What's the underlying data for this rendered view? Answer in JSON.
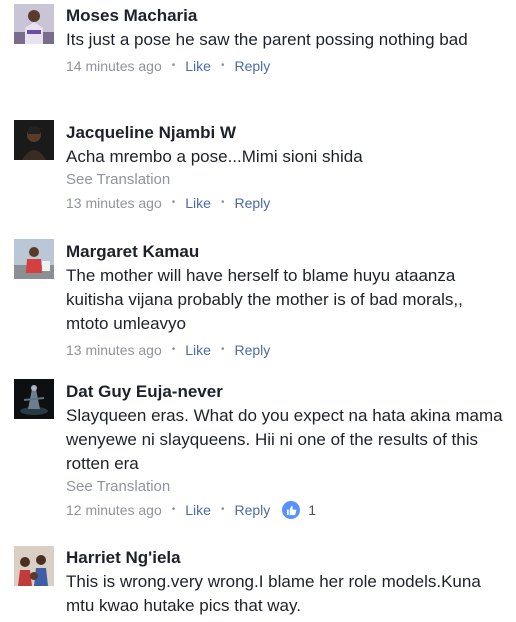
{
  "comments": [
    {
      "author": "Moses Macharia",
      "text": "Its just a pose he saw the parent possing nothing bad",
      "see_translation": "",
      "time": "14 minutes ago",
      "like_label": "Like",
      "reply_label": "Reply",
      "reactions": ""
    },
    {
      "author": "Jacqueline Njambi W",
      "text": "Acha mrembo a pose...Mimi sioni shida",
      "see_translation": "See Translation",
      "time": "13 minutes ago",
      "like_label": "Like",
      "reply_label": "Reply",
      "reactions": ""
    },
    {
      "author": "Margaret Kamau",
      "text": "The mother will have herself to blame huyu ataanza kuitisha vijana probably the mother is of bad morals,, mtoto umleavyo",
      "see_translation": "",
      "time": "13 minutes ago",
      "like_label": "Like",
      "reply_label": "Reply",
      "reactions": ""
    },
    {
      "author": "Dat Guy Euja-never",
      "text": "Slayqueen eras. What do you expect na hata akina mama wenyewe ni slayqueens. Hii ni one of the results of this rotten era",
      "see_translation": "See Translation",
      "time": "12 minutes ago",
      "like_label": "Like",
      "reply_label": "Reply",
      "reactions": "1"
    },
    {
      "author": "Harriet Ng'iela",
      "text": "This is wrong.very wrong.I blame her role models.Kuna mtu kwao hutake pics that way.",
      "see_translation": "",
      "time": "",
      "like_label": "",
      "reply_label": "",
      "reactions": ""
    }
  ],
  "colors": {
    "name": "#1d2129",
    "meta": "#90949c",
    "action": "#4b6aa9",
    "like_badge": "#5890ff"
  },
  "icons": {
    "like_reaction": "thumbs-up-icon",
    "separator": "dot"
  }
}
